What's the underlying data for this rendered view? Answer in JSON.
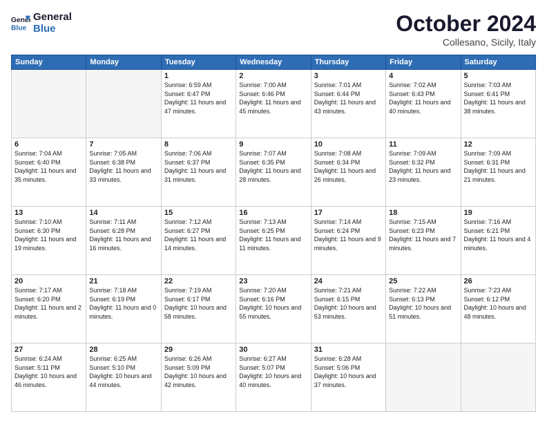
{
  "header": {
    "logo_line1": "General",
    "logo_line2": "Blue",
    "month": "October 2024",
    "location": "Collesano, Sicily, Italy"
  },
  "weekdays": [
    "Sunday",
    "Monday",
    "Tuesday",
    "Wednesday",
    "Thursday",
    "Friday",
    "Saturday"
  ],
  "weeks": [
    [
      {
        "day": "",
        "empty": true
      },
      {
        "day": "",
        "empty": true
      },
      {
        "day": "1",
        "rise": "6:59 AM",
        "set": "6:47 PM",
        "daylight": "11 hours and 47 minutes."
      },
      {
        "day": "2",
        "rise": "7:00 AM",
        "set": "6:46 PM",
        "daylight": "11 hours and 45 minutes."
      },
      {
        "day": "3",
        "rise": "7:01 AM",
        "set": "6:44 PM",
        "daylight": "11 hours and 43 minutes."
      },
      {
        "day": "4",
        "rise": "7:02 AM",
        "set": "6:43 PM",
        "daylight": "11 hours and 40 minutes."
      },
      {
        "day": "5",
        "rise": "7:03 AM",
        "set": "6:41 PM",
        "daylight": "11 hours and 38 minutes."
      }
    ],
    [
      {
        "day": "6",
        "rise": "7:04 AM",
        "set": "6:40 PM",
        "daylight": "11 hours and 35 minutes."
      },
      {
        "day": "7",
        "rise": "7:05 AM",
        "set": "6:38 PM",
        "daylight": "11 hours and 33 minutes."
      },
      {
        "day": "8",
        "rise": "7:06 AM",
        "set": "6:37 PM",
        "daylight": "11 hours and 31 minutes."
      },
      {
        "day": "9",
        "rise": "7:07 AM",
        "set": "6:35 PM",
        "daylight": "11 hours and 28 minutes."
      },
      {
        "day": "10",
        "rise": "7:08 AM",
        "set": "6:34 PM",
        "daylight": "11 hours and 26 minutes."
      },
      {
        "day": "11",
        "rise": "7:09 AM",
        "set": "6:32 PM",
        "daylight": "11 hours and 23 minutes."
      },
      {
        "day": "12",
        "rise": "7:09 AM",
        "set": "6:31 PM",
        "daylight": "11 hours and 21 minutes."
      }
    ],
    [
      {
        "day": "13",
        "rise": "7:10 AM",
        "set": "6:30 PM",
        "daylight": "11 hours and 19 minutes."
      },
      {
        "day": "14",
        "rise": "7:11 AM",
        "set": "6:28 PM",
        "daylight": "11 hours and 16 minutes."
      },
      {
        "day": "15",
        "rise": "7:12 AM",
        "set": "6:27 PM",
        "daylight": "11 hours and 14 minutes."
      },
      {
        "day": "16",
        "rise": "7:13 AM",
        "set": "6:25 PM",
        "daylight": "11 hours and 11 minutes."
      },
      {
        "day": "17",
        "rise": "7:14 AM",
        "set": "6:24 PM",
        "daylight": "11 hours and 9 minutes."
      },
      {
        "day": "18",
        "rise": "7:15 AM",
        "set": "6:23 PM",
        "daylight": "11 hours and 7 minutes."
      },
      {
        "day": "19",
        "rise": "7:16 AM",
        "set": "6:21 PM",
        "daylight": "11 hours and 4 minutes."
      }
    ],
    [
      {
        "day": "20",
        "rise": "7:17 AM",
        "set": "6:20 PM",
        "daylight": "11 hours and 2 minutes."
      },
      {
        "day": "21",
        "rise": "7:18 AM",
        "set": "6:19 PM",
        "daylight": "11 hours and 0 minutes."
      },
      {
        "day": "22",
        "rise": "7:19 AM",
        "set": "6:17 PM",
        "daylight": "10 hours and 58 minutes."
      },
      {
        "day": "23",
        "rise": "7:20 AM",
        "set": "6:16 PM",
        "daylight": "10 hours and 55 minutes."
      },
      {
        "day": "24",
        "rise": "7:21 AM",
        "set": "6:15 PM",
        "daylight": "10 hours and 53 minutes."
      },
      {
        "day": "25",
        "rise": "7:22 AM",
        "set": "6:13 PM",
        "daylight": "10 hours and 51 minutes."
      },
      {
        "day": "26",
        "rise": "7:23 AM",
        "set": "6:12 PM",
        "daylight": "10 hours and 48 minutes."
      }
    ],
    [
      {
        "day": "27",
        "rise": "6:24 AM",
        "set": "5:11 PM",
        "daylight": "10 hours and 46 minutes."
      },
      {
        "day": "28",
        "rise": "6:25 AM",
        "set": "5:10 PM",
        "daylight": "10 hours and 44 minutes."
      },
      {
        "day": "29",
        "rise": "6:26 AM",
        "set": "5:09 PM",
        "daylight": "10 hours and 42 minutes."
      },
      {
        "day": "30",
        "rise": "6:27 AM",
        "set": "5:07 PM",
        "daylight": "10 hours and 40 minutes."
      },
      {
        "day": "31",
        "rise": "6:28 AM",
        "set": "5:06 PM",
        "daylight": "10 hours and 37 minutes."
      },
      {
        "day": "",
        "empty": true
      },
      {
        "day": "",
        "empty": true
      }
    ]
  ],
  "labels": {
    "sunrise": "Sunrise:",
    "sunset": "Sunset:",
    "daylight": "Daylight:"
  }
}
